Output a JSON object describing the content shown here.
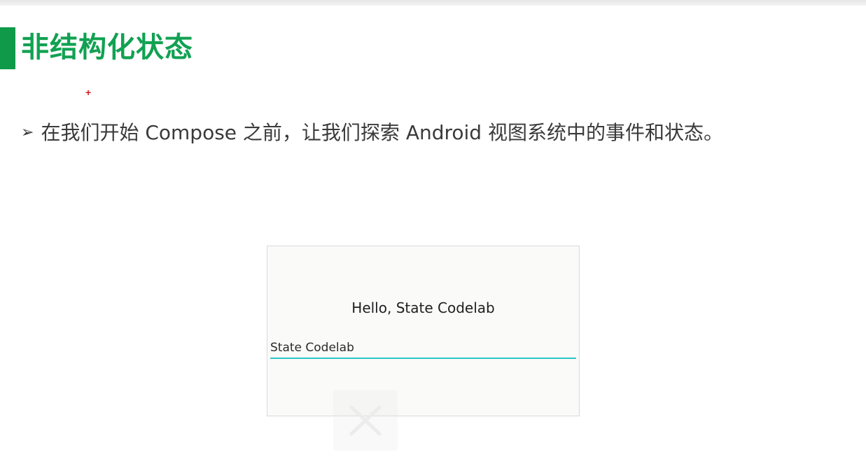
{
  "slide": {
    "title": "非结构化状态",
    "bullet": "在我们开始 Compose 之前，让我们探索 Android 视图系统中的事件和状态。",
    "bullet_marker": "➢",
    "cursor_marker": "+"
  },
  "demo": {
    "greeting": "Hello, State Codelab",
    "input_value": "State Codelab"
  },
  "icons": {
    "bullet": "arrowhead-bullet-icon",
    "close": "close-icon"
  },
  "colors": {
    "accent_green": "#11a152",
    "title_bar_green": "#0f9a4a",
    "input_underline": "#2cc6c8",
    "cursor_red": "#d32020"
  }
}
